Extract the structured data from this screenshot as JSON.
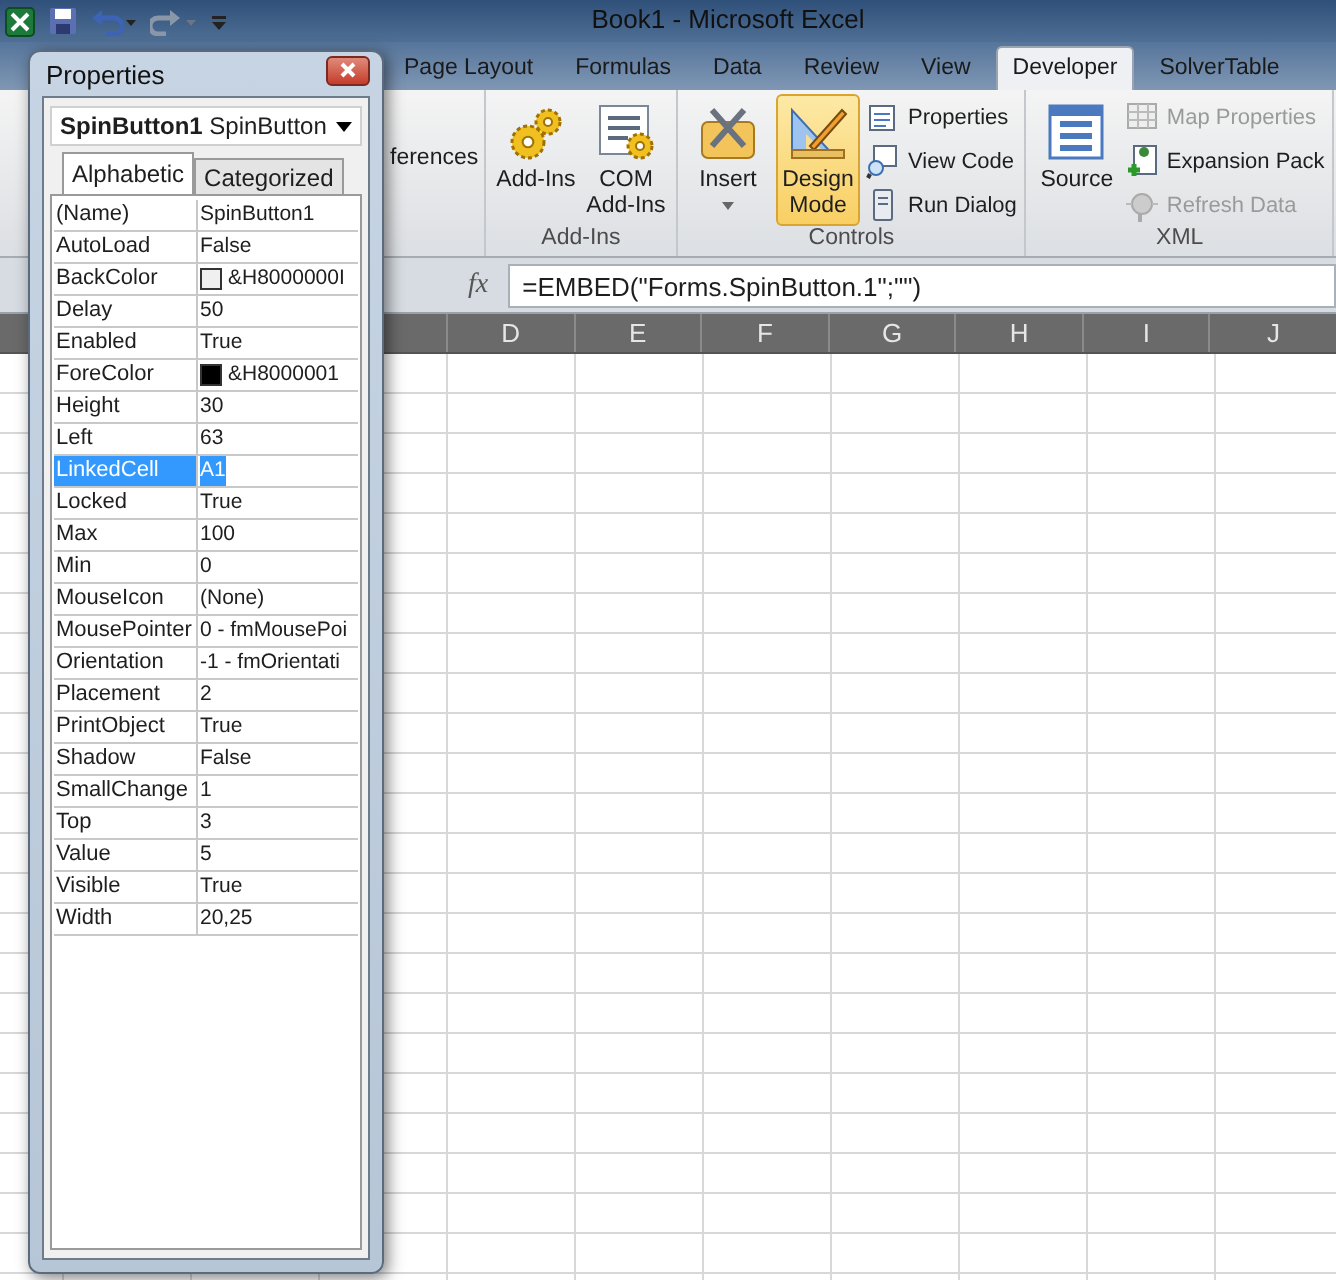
{
  "window": {
    "title": "Book1  -  Microsoft Excel"
  },
  "ribbon_tabs": [
    {
      "label": "Page Layout",
      "selected": false
    },
    {
      "label": "Formulas",
      "selected": false
    },
    {
      "label": "Data",
      "selected": false
    },
    {
      "label": "Review",
      "selected": false
    },
    {
      "label": "View",
      "selected": false
    },
    {
      "label": "Developer",
      "selected": true
    },
    {
      "label": "SolverTable",
      "selected": false
    }
  ],
  "ribbon": {
    "partial_label": "ferences",
    "groups": [
      {
        "label": "Add-Ins",
        "large": [
          {
            "label": "Add-Ins",
            "selected": false,
            "dropdown": false
          },
          {
            "label": "COM\nAdd-Ins",
            "selected": false,
            "dropdown": false
          }
        ]
      },
      {
        "label": "Controls",
        "large": [
          {
            "label": "Insert",
            "selected": false,
            "dropdown": true
          },
          {
            "label": "Design\nMode",
            "selected": true,
            "dropdown": false
          }
        ],
        "small": [
          {
            "label": "Properties",
            "disabled": false
          },
          {
            "label": "View Code",
            "disabled": false
          },
          {
            "label": "Run Dialog",
            "disabled": false
          }
        ]
      },
      {
        "label": "XML",
        "large": [
          {
            "label": "Source",
            "selected": false,
            "dropdown": false
          }
        ],
        "small": [
          {
            "label": "Map Properties",
            "disabled": true
          },
          {
            "label": "Expansion Pack",
            "disabled": false
          },
          {
            "label": "Refresh Data",
            "disabled": true
          }
        ]
      }
    ]
  },
  "formula_bar": {
    "function_label": "fx",
    "formula": "=EMBED(\"Forms.SpinButton.1\";\"\")"
  },
  "sheet": {
    "columns": [
      "D",
      "E",
      "F",
      "G",
      "H",
      "I",
      "J"
    ]
  },
  "properties_window": {
    "title": "Properties",
    "object": "**SpinButton1** SpinButton",
    "tabs": [
      {
        "label": "Alphabetic",
        "selected": true
      },
      {
        "label": "Categorized",
        "selected": false
      }
    ],
    "rows": [
      {
        "name": "(Name)",
        "value": "SpinButton1",
        "selected": false
      },
      {
        "name": "AutoLoad",
        "value": "False",
        "selected": false
      },
      {
        "name": "BackColor",
        "value": "&H8000000I",
        "selected": false,
        "color": "#f0f0f0"
      },
      {
        "name": "Delay",
        "value": "50",
        "selected": false
      },
      {
        "name": "Enabled",
        "value": "True",
        "selected": false
      },
      {
        "name": "ForeColor",
        "value": "&H8000001",
        "selected": false,
        "color": "#000000"
      },
      {
        "name": "Height",
        "value": "30",
        "selected": false
      },
      {
        "name": "Left",
        "value": "63",
        "selected": false
      },
      {
        "name": "LinkedCell",
        "value": "A1",
        "selected": true
      },
      {
        "name": "Locked",
        "value": "True",
        "selected": false
      },
      {
        "name": "Max",
        "value": "100",
        "selected": false
      },
      {
        "name": "Min",
        "value": "0",
        "selected": false
      },
      {
        "name": "MouseIcon",
        "value": "(None)",
        "selected": false
      },
      {
        "name": "MousePointer",
        "value": "0 - fmMousePoi",
        "selected": false
      },
      {
        "name": "Orientation",
        "value": "-1 - fmOrientati",
        "selected": false
      },
      {
        "name": "Placement",
        "value": "2",
        "selected": false
      },
      {
        "name": "PrintObject",
        "value": "True",
        "selected": false
      },
      {
        "name": "Shadow",
        "value": "False",
        "selected": false
      },
      {
        "name": "SmallChange",
        "value": "1",
        "selected": false
      },
      {
        "name": "Top",
        "value": "3",
        "selected": false
      },
      {
        "name": "Value",
        "value": "5",
        "selected": false
      },
      {
        "name": "Visible",
        "value": "True",
        "selected": false
      },
      {
        "name": "Width",
        "value": "20,25",
        "selected": false
      }
    ]
  }
}
